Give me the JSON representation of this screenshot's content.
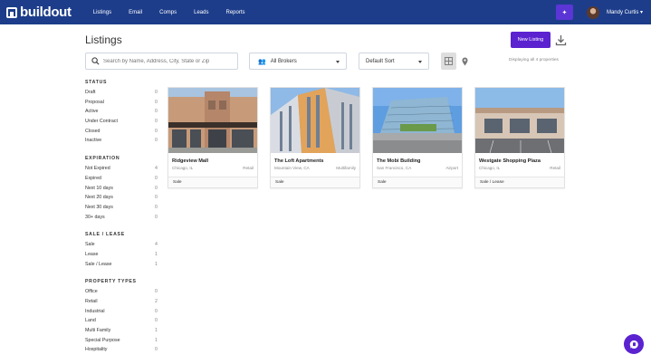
{
  "app": {
    "logo_text": "buildout"
  },
  "nav": {
    "items": [
      "Listings",
      "Email",
      "Comps",
      "Leads",
      "Reports"
    ]
  },
  "user": {
    "name": "Mandy Curtis ▾"
  },
  "page": {
    "title": "Listings",
    "new_button": "New Listing"
  },
  "search": {
    "placeholder": "Search by Name, Address, City, State or Zip"
  },
  "brokers_select": {
    "value": "All Brokers"
  },
  "sort_select": {
    "value": "Default Sort"
  },
  "count_text": "Displaying all 4 properties",
  "filters": [
    {
      "heading": "STATUS",
      "rows": [
        {
          "label": "Draft",
          "count": "0"
        },
        {
          "label": "Proposal",
          "count": "0"
        },
        {
          "label": "Active",
          "count": "0"
        },
        {
          "label": "Under Contract",
          "count": "0"
        },
        {
          "label": "Closed",
          "count": "0"
        },
        {
          "label": "Inactive",
          "count": "0"
        }
      ]
    },
    {
      "heading": "EXPIRATION",
      "rows": [
        {
          "label": "Not Expired",
          "count": "4"
        },
        {
          "label": "Expired",
          "count": "0"
        },
        {
          "label": "Next 10 days",
          "count": "0"
        },
        {
          "label": "Next 20 days",
          "count": "0"
        },
        {
          "label": "Next 30 days",
          "count": "0"
        },
        {
          "label": "30+ days",
          "count": "0"
        }
      ]
    },
    {
      "heading": "SALE / LEASE",
      "rows": [
        {
          "label": "Sale",
          "count": "4"
        },
        {
          "label": "Lease",
          "count": "1"
        },
        {
          "label": "Sale / Lease",
          "count": "1"
        }
      ]
    },
    {
      "heading": "PROPERTY TYPES",
      "rows": [
        {
          "label": "Office",
          "count": "0"
        },
        {
          "label": "Retail",
          "count": "2"
        },
        {
          "label": "Industrial",
          "count": "0"
        },
        {
          "label": "Land",
          "count": "0"
        },
        {
          "label": "Multi Family",
          "count": "1"
        },
        {
          "label": "Special Purpose",
          "count": "1"
        },
        {
          "label": "Hospitality",
          "count": "0"
        }
      ]
    }
  ],
  "listings": [
    {
      "name": "Ridgeview Mall",
      "city": "Chicago, IL",
      "type": "Retail",
      "deal": "Sale"
    },
    {
      "name": "The Loft Apartments",
      "city": "Mountain View, CA",
      "type": "Multifamily",
      "deal": "Sale"
    },
    {
      "name": "The Mobi Building",
      "city": "San Francisco, CA",
      "type": "Airport",
      "deal": "Sale"
    },
    {
      "name": "Westgate Shopping Plaza",
      "city": "Chicago, IL",
      "type": "Retail",
      "deal": "Sale / Lease"
    }
  ],
  "colors": {
    "nav_bg": "#1d3d8a",
    "accent": "#5b22d0"
  }
}
